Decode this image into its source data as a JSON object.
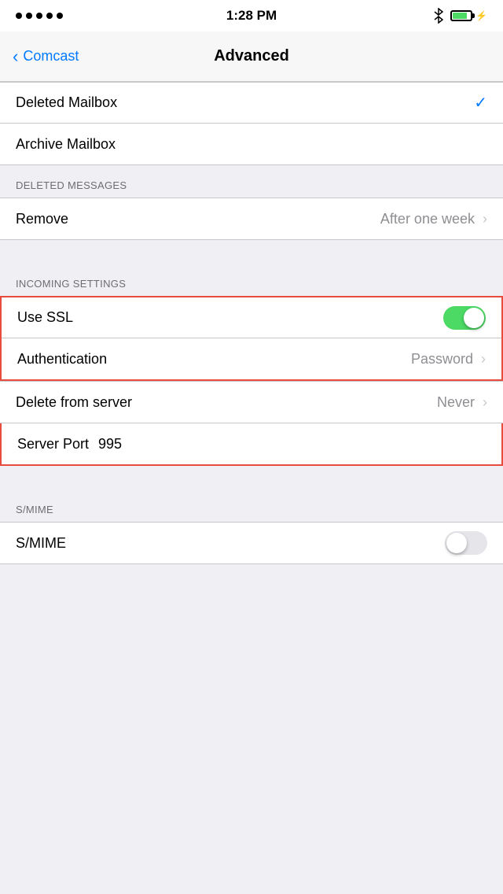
{
  "statusBar": {
    "time": "1:28 PM"
  },
  "navBar": {
    "backLabel": "Comcast",
    "title": "Advanced"
  },
  "mailboxSection": {
    "items": [
      {
        "label": "Deleted Mailbox",
        "hasCheckmark": true
      },
      {
        "label": "Archive Mailbox",
        "hasCheckmark": false
      }
    ]
  },
  "deletedMessagesSection": {
    "header": "DELETED MESSAGES",
    "items": [
      {
        "label": "Remove",
        "value": "After one week",
        "hasChevron": true
      }
    ]
  },
  "incomingSettingsSection": {
    "header": "INCOMING SETTINGS",
    "items": [
      {
        "label": "Use SSL",
        "type": "toggle",
        "toggleOn": true
      },
      {
        "label": "Authentication",
        "value": "Password",
        "hasChevron": true
      }
    ]
  },
  "serverSection": {
    "items": [
      {
        "label": "Delete from server",
        "value": "Never",
        "hasChevron": true
      }
    ]
  },
  "serverPortRow": {
    "label": "Server Port",
    "value": "995"
  },
  "smimeSection": {
    "header": "S/MIME",
    "items": [
      {
        "label": "S/MIME",
        "type": "toggle",
        "toggleOn": false
      }
    ]
  },
  "icons": {
    "checkmark": "✓",
    "chevron": "›",
    "backChevron": "‹"
  }
}
